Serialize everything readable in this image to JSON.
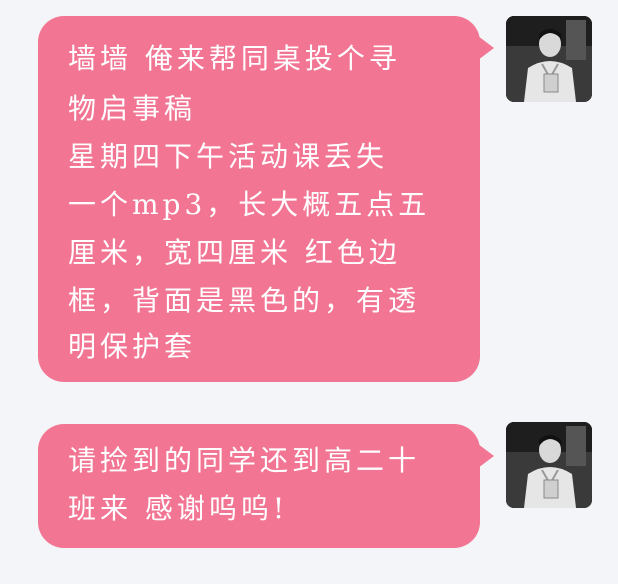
{
  "chat": {
    "bubble_color": "#f27593",
    "text_color": "#ffffff",
    "background": "#f4f5f9",
    "messages": [
      {
        "sender": "self",
        "lines": [
          "墙墙 俺来帮同桌投个寻",
          "物启事稿",
          "星期四下午活动课丢失",
          "一个mp3，长大概五点五",
          "厘米，宽四厘米 红色边",
          "框，背面是黑色的，有透",
          "明保护套"
        ]
      },
      {
        "sender": "self",
        "lines": [
          "请捡到的同学还到高二十",
          "班来 感谢呜呜!"
        ]
      }
    ],
    "avatar_icon": "user-avatar-photo"
  }
}
